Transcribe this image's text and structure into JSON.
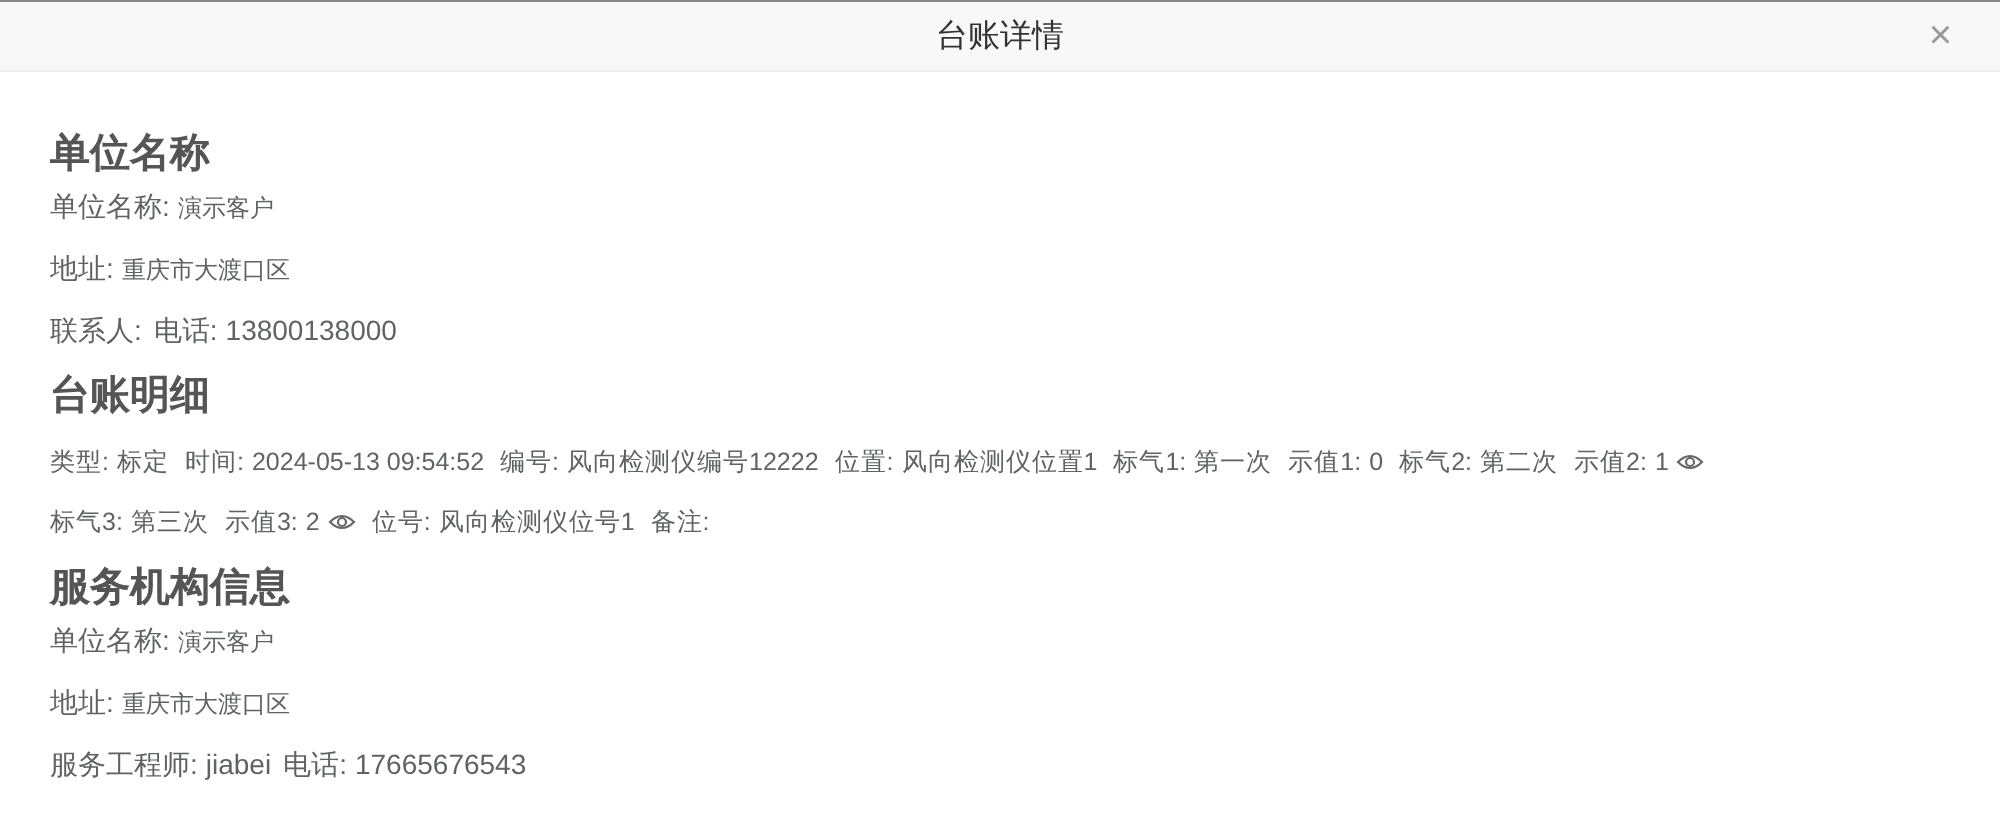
{
  "dialog": {
    "title": "台账详情",
    "close": "×"
  },
  "sections": [
    {
      "heading": "单位名称",
      "lines": [
        [
          {
            "label": "单位名称:",
            "value": "演示客户",
            "kind": "small"
          }
        ],
        [
          {
            "label": "地址:",
            "value": "重庆市大渡口区",
            "kind": "small"
          }
        ],
        [
          {
            "label": "联系人:",
            "kind": "plain"
          },
          {
            "label": "电话:",
            "value": "13800138000",
            "kind": "plain"
          }
        ]
      ]
    },
    {
      "heading": "台账明细",
      "lines": [
        [
          {
            "label": "类型:",
            "value": "标定",
            "kind": "plain"
          },
          {
            "label": "时间:",
            "value": "2024-05-13 09:54:52",
            "kind": "plain"
          },
          {
            "label": "编号:",
            "value": "风向检测仪编号12222",
            "kind": "plain"
          },
          {
            "label": "位置:",
            "value": "风向检测仪位置1",
            "kind": "plain"
          },
          {
            "label": "标气1:",
            "value": "第一次",
            "kind": "plain"
          },
          {
            "label": "示值1:",
            "value": "0",
            "kind": "plain"
          },
          {
            "label": "标气2:",
            "value": "第二次",
            "kind": "plain"
          },
          {
            "label": "示值2:",
            "value": "1",
            "kind": "eye"
          }
        ],
        [
          {
            "label": "标气3:",
            "value": "第三次",
            "kind": "plain"
          },
          {
            "label": "示值3:",
            "value": "2",
            "kind": "eye"
          },
          {
            "label": "位号:",
            "value": "风向检测仪位号1",
            "kind": "plain"
          },
          {
            "label": "备注:",
            "kind": "plain"
          }
        ]
      ]
    },
    {
      "heading": "服务机构信息",
      "lines": [
        [
          {
            "label": "单位名称:",
            "value": "演示客户",
            "kind": "small"
          }
        ],
        [
          {
            "label": "地址:",
            "value": "重庆市大渡口区",
            "kind": "small"
          }
        ],
        [
          {
            "label": "服务工程师:",
            "value": "jiabei",
            "kind": "plain"
          },
          {
            "label": "电话:",
            "value": "17665676543",
            "kind": "plain"
          }
        ]
      ]
    }
  ]
}
